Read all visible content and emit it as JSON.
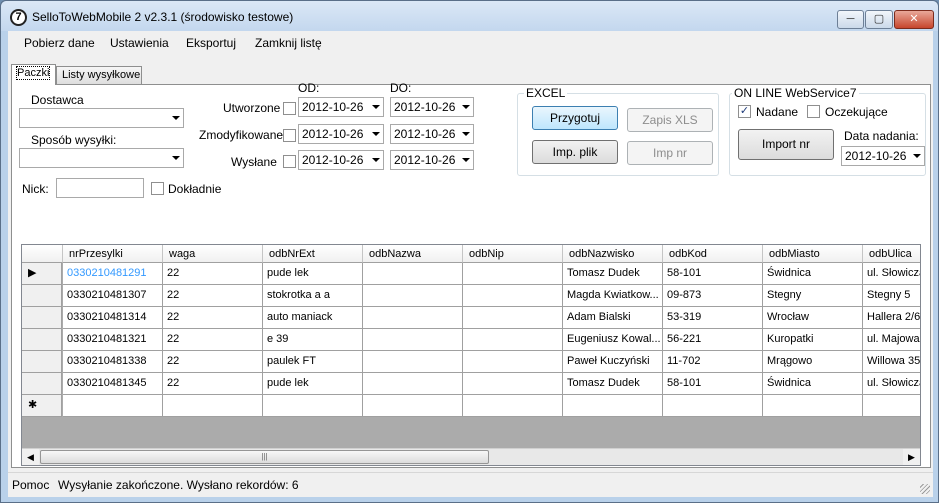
{
  "window": {
    "title": "SelloToWebMobile 2 v2.3.1 (środowisko testowe)",
    "app_icon_glyph": "7",
    "minimize_glyph": "─",
    "maximize_glyph": "▢",
    "close_glyph": "✕"
  },
  "menu": [
    {
      "label": "Pobierz dane"
    },
    {
      "label": "Ustawienia"
    },
    {
      "label": "Eksportuj"
    },
    {
      "label": "Zamknij listę"
    }
  ],
  "tabs": [
    {
      "label": "Paczki",
      "active": true
    },
    {
      "label": "Listy wysyłkowe",
      "active": false
    }
  ],
  "filters": {
    "dostawca_label": "Dostawca",
    "dostawca_value": "",
    "sposob_label": "Sposób wysyłki:",
    "sposob_value": "",
    "nick_label": "Nick:",
    "nick_value": "",
    "dokladnie_label": "Dokładnie",
    "od_label": "OD:",
    "do_label": "DO:",
    "dates": [
      {
        "label": "Utworzone",
        "checked": false,
        "od": "2012-10-26",
        "do": "2012-10-26"
      },
      {
        "label": "Zmodyfikowane",
        "checked": false,
        "od": "2012-10-26",
        "do": "2012-10-26"
      },
      {
        "label": "Wysłane",
        "checked": false,
        "od": "2012-10-26",
        "do": "2012-10-26"
      }
    ]
  },
  "excel": {
    "title": "EXCEL",
    "przygotuj": "Przygotuj",
    "zapis_xls": "Zapis XLS",
    "imp_plik": "Imp. plik",
    "imp_nr": "Imp nr"
  },
  "online": {
    "title": "ON LINE WebService7",
    "nadane_label": "Nadane",
    "nadane_checked": true,
    "oczekujace_label": "Oczekujące",
    "oczekujace_checked": false,
    "check_glyph": "✓",
    "import_nr": "Import nr",
    "data_nadania_label": "Data nadania:",
    "data_nadania_value": "2012-10-26"
  },
  "grid": {
    "columns": [
      "nrPrzesylki",
      "waga",
      "odbNrExt",
      "odbNazwa",
      "odbNip",
      "odbNazwisko",
      "odbKod",
      "odbMiasto",
      "odbUlica"
    ],
    "current_row_marker": "▶",
    "new_row_marker": "✱",
    "rows": [
      [
        "0330210481291",
        "22",
        "pude lek",
        "",
        "",
        "Tomasz Dudek",
        "58-101",
        "Świdnica",
        "ul. Słowicza"
      ],
      [
        "0330210481307",
        "22",
        "stokrotka a a",
        "",
        "",
        "Magda Kwiatkow...",
        "09-873",
        "Stegny",
        "Stegny 5"
      ],
      [
        "0330210481314",
        "22",
        "auto maniack",
        "",
        "",
        "Adam Bialski",
        "53-319",
        "Wrocław",
        "Hallera 2/6"
      ],
      [
        "0330210481321",
        "22",
        "e 39",
        "",
        "",
        "Eugeniusz Kowal...",
        "56-221",
        "Kuropatki",
        "ul. Majowa"
      ],
      [
        "0330210481338",
        "22",
        "paulek FT",
        "",
        "",
        "Paweł Kuczyński",
        "11-702",
        "Mrągowo",
        "Willowa 35"
      ],
      [
        "0330210481345",
        "22",
        "pude lek",
        "",
        "",
        "Tomasz Dudek",
        "58-101",
        "Świdnica",
        "ul. Słowicza"
      ]
    ],
    "scroll_left": "◀",
    "scroll_right": "▶",
    "thumb_grip": "|||"
  },
  "status": {
    "label": "Pomoc",
    "message": "Wysyłanie zakończone. Wysłano rekordów: 6"
  }
}
